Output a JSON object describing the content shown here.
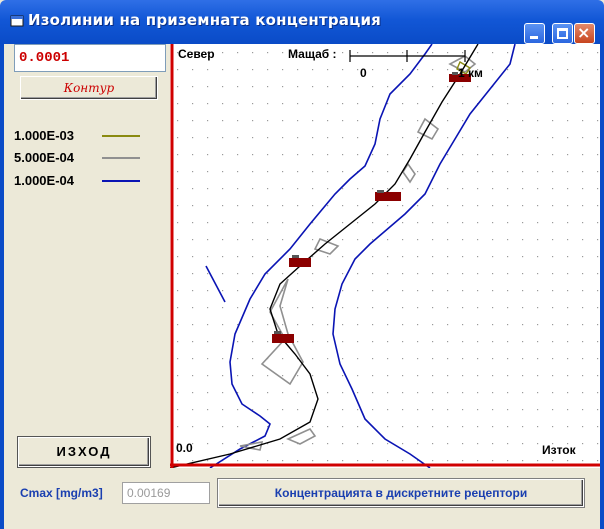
{
  "window": {
    "title": "Изолинии на приземната концентрация",
    "icon": "window-app-icon",
    "controls": [
      "minimize-icon",
      "maximize-icon",
      "close-icon"
    ]
  },
  "left_panel": {
    "contour_value": "0.0001",
    "contour_button_label": "Контур",
    "legend": [
      {
        "label": "1.000E-03",
        "color": "#8a8a10"
      },
      {
        "label": "5.000E-04",
        "color": "#909090"
      },
      {
        "label": "1.000E-04",
        "color": "#0a14b4"
      }
    ],
    "exit_button_label": "ИЗХОД"
  },
  "plot": {
    "north_label": "Север",
    "scale_label": "Мащаб :",
    "scale_start": "0",
    "scale_end": "1 км",
    "origin_label": "0.0",
    "east_label": "Изток",
    "axis_color": "#d00000",
    "grid": "dotted"
  },
  "bottom": {
    "cmax_label": "Cmax [mg/m3]",
    "cmax_value": "0.00169",
    "receptors_button_label": "Концентрацията в дискретните рецептори"
  },
  "colors": {
    "titlebar": "#1257d6",
    "window_bg": "#ece9d8",
    "red_text": "#cc0000",
    "blue_text": "#1a3fb0"
  }
}
